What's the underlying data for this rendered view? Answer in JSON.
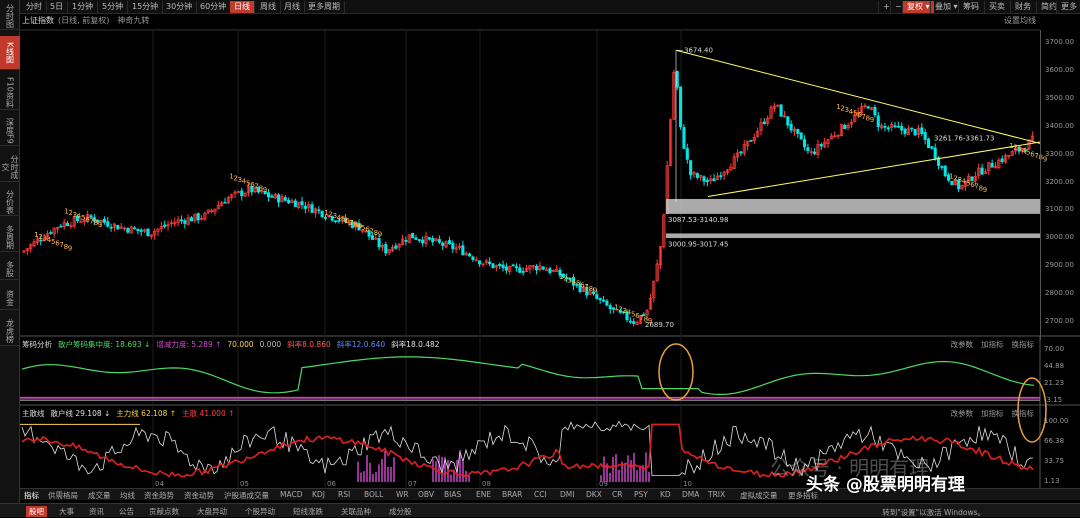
{
  "period_tabs": [
    "分时",
    "5日",
    "1分钟",
    "5分钟",
    "15分钟",
    "30分钟",
    "60分钟",
    "日线",
    "周线",
    "月线",
    "更多周期"
  ],
  "active_period": "日线",
  "toolbar_right": {
    "restore": "复权",
    "overlay": "叠加",
    "chips": "筹码",
    "buy_sell": "买卖",
    "financial": "财务",
    "simple": "简约",
    "more": "更多"
  },
  "sidebar": [
    "分时图",
    "K线图",
    "F10资料",
    "深度F9",
    "分时成交",
    "分价表",
    "多周期",
    "多股",
    "资金",
    "龙虎榜"
  ],
  "active_sidebar": "K线图",
  "chart": {
    "title": "上证指数",
    "subtitle": "(日线, 前复权)",
    "extra": "神奇九转",
    "settings": "设置均线",
    "y_ticks": [
      "3700.00",
      "3600.00",
      "3500.00",
      "3400.00",
      "3300.00",
      "3200.00",
      "3100.00",
      "3000.00",
      "2900.00",
      "2800.00",
      "2700.00"
    ],
    "month_labels": [
      "04",
      "05",
      "06",
      "07",
      "08",
      "09",
      "10"
    ],
    "annotations": {
      "high": "3674.40",
      "low": "2689.70",
      "gap1": "3087.53-3140.98",
      "gap2": "3000.95-3017.45",
      "trend": "3261.76-3361.73"
    }
  },
  "indicator1": {
    "name": "筹码分析",
    "items": [
      {
        "text": "散户筹码集中度: 18.693 ↓",
        "color": "#4cd964"
      },
      {
        "text": "增减力度: 5.289 ↑",
        "color": "#d04bd0"
      },
      {
        "text": "70.000",
        "color": "#ffd24a"
      },
      {
        "text": "0.000",
        "color": "#bbbbbb"
      },
      {
        "text": "斜率8.0.860",
        "color": "#ff5a5a"
      },
      {
        "text": "斜率12.0.640",
        "color": "#5a8cff"
      },
      {
        "text": "斜率18.0.482",
        "color": "#e0e0e0"
      }
    ],
    "y_ticks": [
      "70.00",
      "44.88",
      "21.23",
      "-3.15"
    ],
    "buttons": [
      "改参数",
      "加指标",
      "换指标"
    ]
  },
  "indicator2": {
    "name": "主散线",
    "items": [
      {
        "text": "散户线 29.108 ↓",
        "color": "#e0e0e0"
      },
      {
        "text": "主力线 62.108 ↑",
        "color": "#ffd24a"
      },
      {
        "text": "主散 41.000 ↑",
        "color": "#ff4040"
      }
    ],
    "y_ticks": [
      "100.00",
      "66.38",
      "33.75",
      "1.13"
    ],
    "buttons": [
      "改参数",
      "加指标",
      "换指标"
    ]
  },
  "indicator_tabs": [
    "指标",
    "供需格局",
    "成交量",
    "均线",
    "资金趋势",
    "资金动势",
    "沪股通成交量",
    "MACD",
    "KDJ",
    "RSI",
    "BOLL",
    "WR",
    "OBV",
    "BIAS",
    "ENE",
    "BRAR",
    "CCI",
    "DMI",
    "DKX",
    "CR",
    "PSY",
    "KD",
    "DMA",
    "TRIX",
    "虚拟成交量",
    "更多指标"
  ],
  "bottom_tabs": [
    "股吧",
    "大事",
    "资讯",
    "公告",
    "贡献点数",
    "大盘异动",
    "个股异动",
    "短线涨跌",
    "关联品种",
    "成分股"
  ],
  "windows_notice": "转到\"设置\"以激活 Windows。",
  "watermark": "头条 @股票明明有理",
  "brand": "公众号 · 明明有理",
  "colors": {
    "up": "#ff3b3b",
    "down": "#00e5e5",
    "accent": "#c0392b",
    "trend": "#ffff66"
  }
}
